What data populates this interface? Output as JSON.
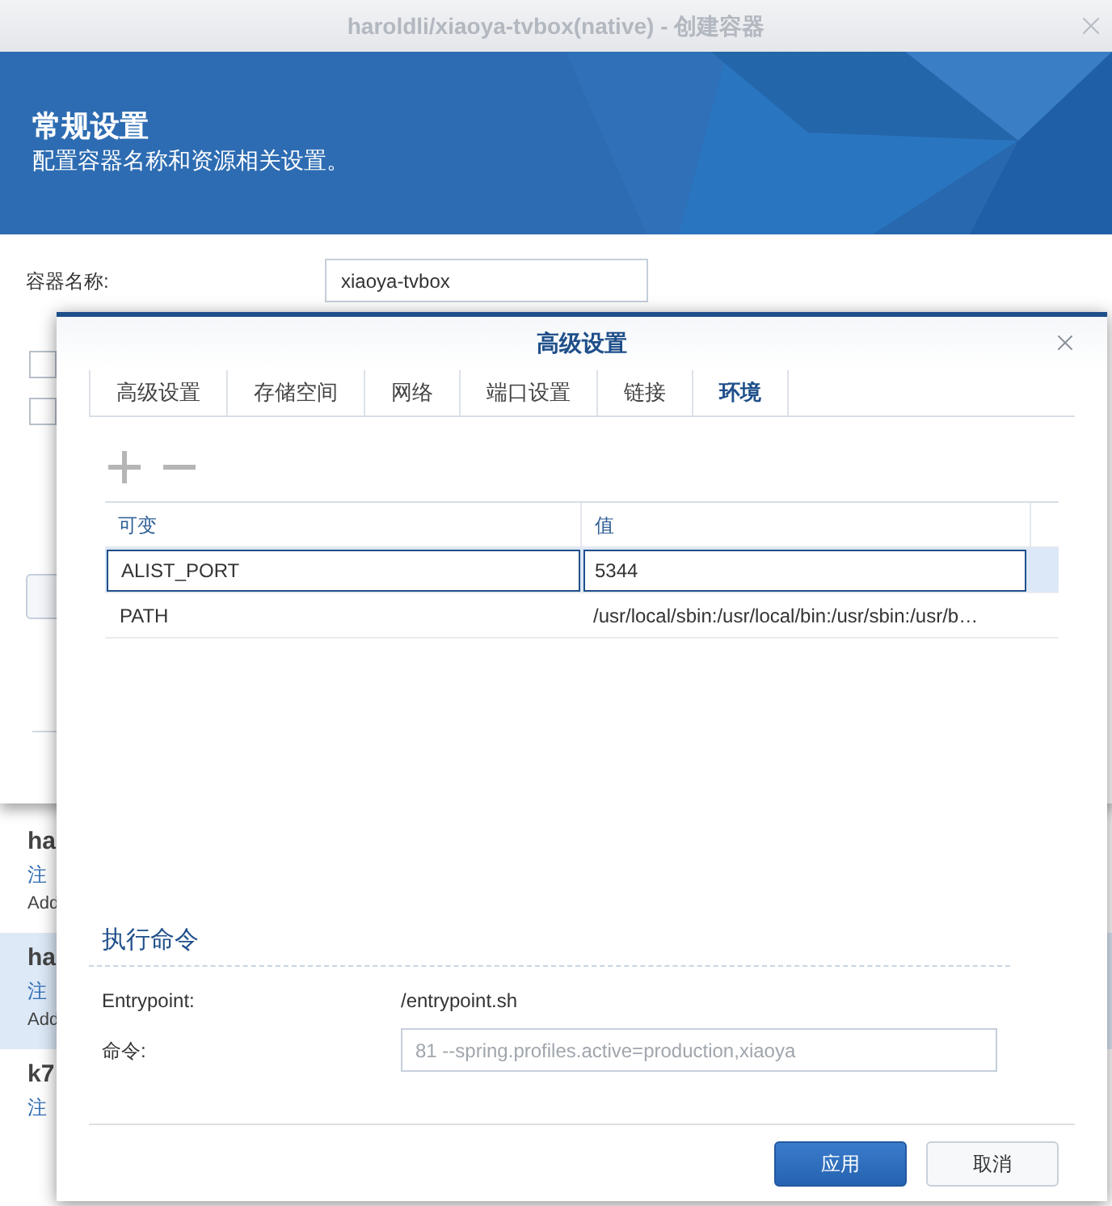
{
  "window": {
    "title": "haroldli/xiaoya-tvbox(native) - 创建容器"
  },
  "header": {
    "title": "常规设置",
    "subtitle": "配置容器名称和资源相关设置。"
  },
  "form": {
    "name_label": "容器名称:",
    "name_value": "xiaoya-tvbox",
    "checkboxes": [
      {
        "checked": false
      },
      {
        "checked": false
      }
    ]
  },
  "background_list": [
    {
      "title": "ha",
      "line_1": "注",
      "line_2": "Add",
      "selected": false
    },
    {
      "title": "ha",
      "line_1": "注",
      "line_2": "Add",
      "selected": true
    },
    {
      "title": "k7",
      "line_1": "注",
      "selected": false
    }
  ],
  "dialog": {
    "title": "高级设置",
    "tabs": [
      {
        "label": "高级设置",
        "selected": false
      },
      {
        "label": "存储空间",
        "selected": false
      },
      {
        "label": "网络",
        "selected": false
      },
      {
        "label": "端口设置",
        "selected": false
      },
      {
        "label": "链接",
        "selected": false
      },
      {
        "label": "环境",
        "selected": true
      }
    ],
    "table": {
      "columns": [
        "可变",
        "值"
      ],
      "rows": [
        {
          "variable": "ALIST_PORT",
          "value": "5344",
          "selected": true
        },
        {
          "variable": "PATH",
          "value": "/usr/local/sbin:/usr/local/bin:/usr/sbin:/usr/b…",
          "selected": false
        }
      ]
    },
    "command_section": {
      "title": "执行命令",
      "entrypoint_label": "Entrypoint:",
      "entrypoint_value": "/entrypoint.sh",
      "command_label": "命令:",
      "command_value": "81 --spring.profiles.active=production,xiaoya",
      "disabled": true
    },
    "buttons": [
      {
        "label": "应用",
        "kind": "primary"
      },
      {
        "label": "取消",
        "kind": "secondary"
      }
    ]
  }
}
